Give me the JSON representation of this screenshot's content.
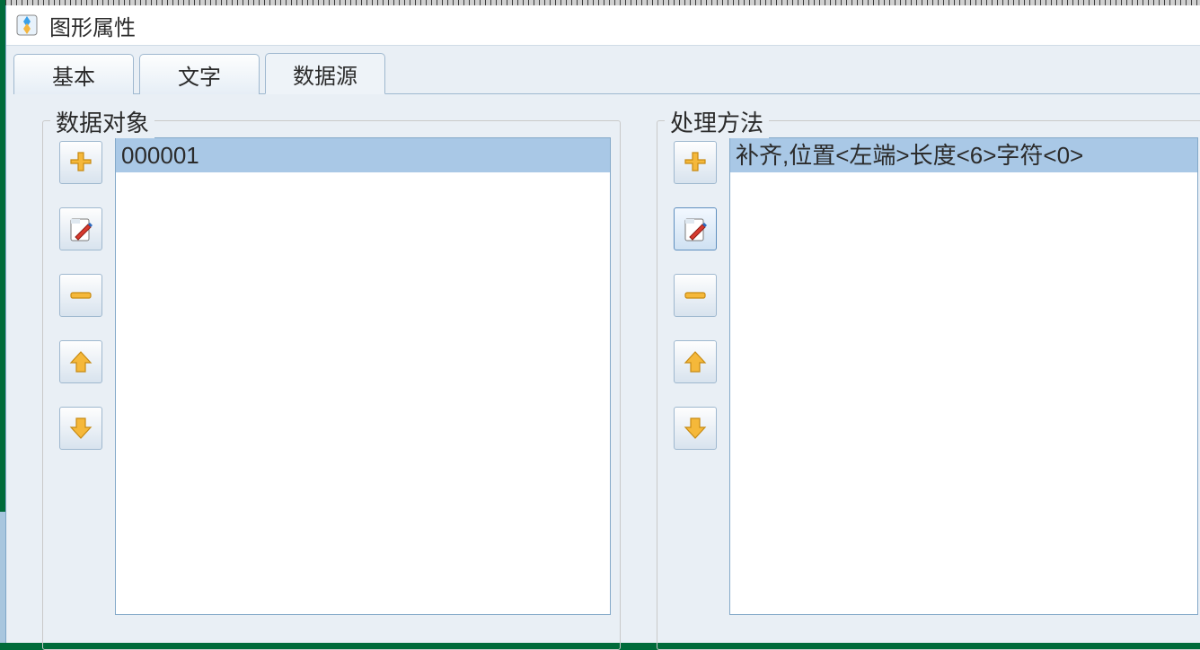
{
  "window": {
    "title": "图形属性"
  },
  "tabs": {
    "items": [
      {
        "label": "基本",
        "active": false
      },
      {
        "label": "文字",
        "active": false
      },
      {
        "label": "数据源",
        "active": true
      }
    ]
  },
  "panels": {
    "data_object": {
      "label": "数据对象",
      "items": [
        {
          "text": "000001",
          "selected": true
        }
      ],
      "buttons": {
        "add": {
          "name": "add-data-button"
        },
        "edit": {
          "name": "edit-data-button"
        },
        "remove": {
          "name": "remove-data-button"
        },
        "up": {
          "name": "move-up-data-button"
        },
        "down": {
          "name": "move-down-data-button"
        }
      },
      "selected_action": null
    },
    "process_method": {
      "label": "处理方法",
      "items": [
        {
          "text": "补齐,位置<左端>长度<6>字符<0>",
          "selected": true
        }
      ],
      "buttons": {
        "add": {
          "name": "add-method-button"
        },
        "edit": {
          "name": "edit-method-button"
        },
        "remove": {
          "name": "remove-method-button"
        },
        "up": {
          "name": "move-up-method-button"
        },
        "down": {
          "name": "move-down-method-button"
        }
      },
      "selected_action": "edit"
    }
  }
}
